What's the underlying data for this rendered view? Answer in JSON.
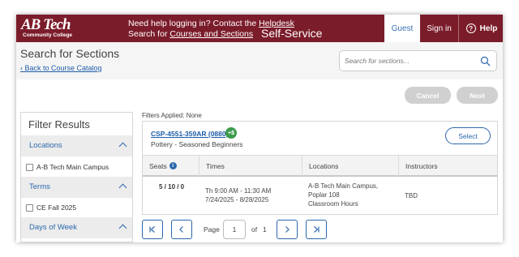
{
  "header": {
    "logo_main": "AB Tech",
    "logo_sub": "Community College",
    "help_line1_prefix": "Need help logging in? Contact the ",
    "help_line1_link": "Helpdesk",
    "help_line2_prefix": "Search for ",
    "help_line2_link": "Courses and Sections",
    "app_title": "Self-Service",
    "nav_guest": "Guest",
    "nav_signin": "Sign in",
    "nav_help": "Help",
    "accent": "#7b1c2a"
  },
  "page": {
    "title": "Search for Sections",
    "back_link": "Back to Course Catalog",
    "search_placeholder": "Search for sections..."
  },
  "actions": {
    "cancel": "Cancel",
    "next": "Next"
  },
  "filter": {
    "title": "Filter Results",
    "facets": [
      {
        "label": "Locations",
        "option": "A-B Tech Main Campus"
      },
      {
        "label": "Terms",
        "option": "CE Fall 2025"
      },
      {
        "label": "Days of Week"
      }
    ]
  },
  "results": {
    "filters_applied": "Filters Applied: None",
    "course_code": "CSP-4551-359AR (0880)",
    "badge": "+$",
    "course_title": "Pottery - Seasoned Beginners",
    "select": "Select",
    "columns": [
      "Seats",
      "Times",
      "Locations",
      "Instructors"
    ],
    "row": {
      "seats": "5 / 10 / 0",
      "time": "Th 9:00 AM - 11:30 AM",
      "dates": "7/24/2025 - 8/28/2025",
      "location_line1": "A-B Tech Main Campus,",
      "location_line2": "Poplar 108",
      "location_line3": "Classroom Hours",
      "instructor": "TBD"
    }
  },
  "pager": {
    "page_label": "Page",
    "current_page": "1",
    "of_label": "of",
    "total_pages": "1"
  }
}
